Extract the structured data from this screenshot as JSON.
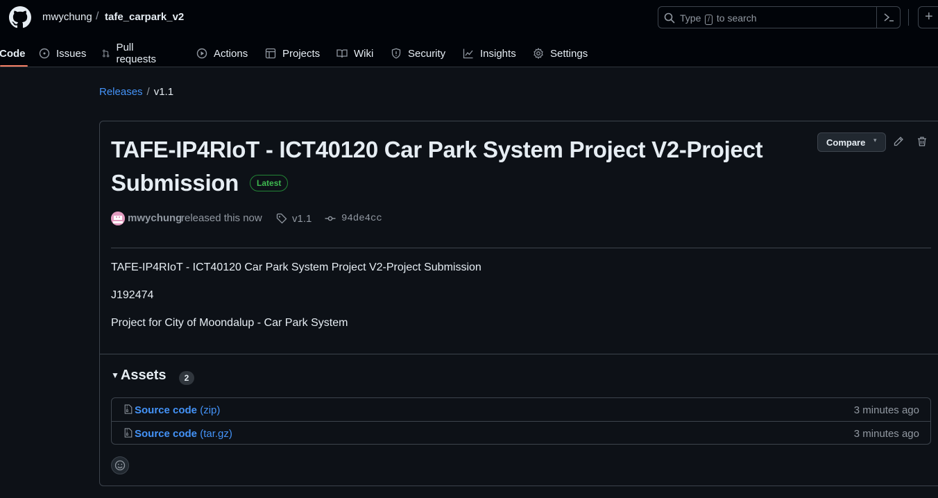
{
  "header": {
    "owner": "mwychung",
    "separator": "/",
    "repo": "tafe_carpark_v2",
    "search_prefix": "Type",
    "search_key": "/",
    "search_suffix": "to search",
    "plus": "+"
  },
  "nav": {
    "code": "Code",
    "issues": "Issues",
    "pull_requests": "Pull requests",
    "actions": "Actions",
    "projects": "Projects",
    "wiki": "Wiki",
    "security": "Security",
    "insights": "Insights",
    "settings": "Settings"
  },
  "breadcrumb": {
    "releases": "Releases",
    "separator": "/",
    "current": "v1.1"
  },
  "release": {
    "title": "TAFE-IP4RIoT - ICT40120 Car Park System Project V2-Project Submission",
    "badge": "Latest",
    "compare_label": "Compare",
    "author": "mwychung",
    "released_text": "released this now",
    "tag": "v1.1",
    "commit": "94de4cc",
    "body": [
      "TAFE-IP4RIoT - ICT40120 Car Park System Project V2-Project Submission",
      "J192474",
      "Project for City of Moondalup - Car Park System"
    ]
  },
  "assets": {
    "heading": "Assets",
    "count": "2",
    "items": [
      {
        "name": "Source code",
        "ext": "(zip)",
        "time": "3 minutes ago"
      },
      {
        "name": "Source code",
        "ext": "(tar.gz)",
        "time": "3 minutes ago"
      }
    ]
  },
  "colors": {
    "background": "#0d1117",
    "header_bg": "#010409",
    "link": "#4493f8",
    "latest_green": "#3fb950",
    "active_tab_underline": "#f78166"
  }
}
